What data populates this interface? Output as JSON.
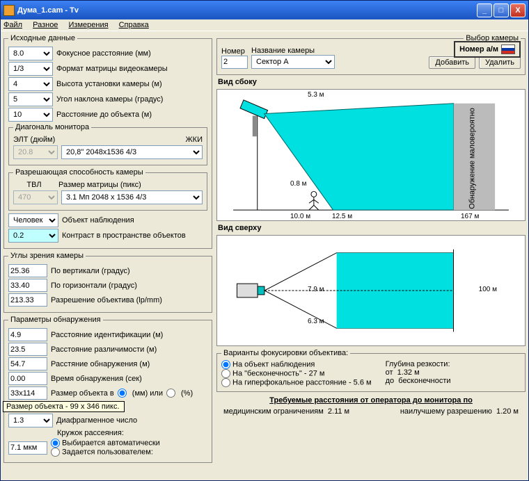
{
  "title": "Дума_1.cam - Tv",
  "menu": {
    "file": "Файл",
    "misc": "Разное",
    "meas": "Измерения",
    "help": "Справка"
  },
  "src": {
    "legend": "Исходные данные",
    "focal": {
      "val": "8.0",
      "lbl": "Фокусное расстояние (мм)"
    },
    "format": {
      "val": "1/3",
      "lbl": "Формат матрицы видеокамеры"
    },
    "height": {
      "val": "4",
      "lbl": "Высота установки камеры (м)"
    },
    "tilt": {
      "val": "5",
      "lbl": "Угол наклона камеры (градус)"
    },
    "dist": {
      "val": "10",
      "lbl": "Расстояние до объекта (м)"
    }
  },
  "mon": {
    "legend": "Диагональ монитора",
    "crt_lbl": "ЭЛТ (дюйм)",
    "crt": "20.8",
    "lcd_lbl": "ЖКИ",
    "lcd": "20,8\"   2048x1536  4/3"
  },
  "res": {
    "legend": "Разрешающая способность камеры",
    "tvl_lbl": "ТВЛ",
    "tvl": "470",
    "mat_lbl": "Размер матрицы (пикс)",
    "mat": "3.1 Мп  2048 x 1536  4/3"
  },
  "obj": {
    "type": "Человек",
    "type_lbl": "Объект наблюдения",
    "contrast": "0.2",
    "contrast_lbl": "Контраст в пространстве объектов"
  },
  "ang": {
    "legend": "Углы зрения камеры",
    "vert": "25.36",
    "vert_lbl": "По вертикали (градус)",
    "horiz": "33.40",
    "horiz_lbl": "По горизонтали (градус)",
    "lens": "213.33",
    "lens_lbl": "Разрешение объектива (lp/mm)"
  },
  "det": {
    "legend": "Параметры обнаружения",
    "id": "4.9",
    "id_lbl": "Расстояние идентификации (м)",
    "rec": "23.5",
    "rec_lbl": "Расстояние различимости (м)",
    "dete": "54.7",
    "dete_lbl": "Расстяние обнаружения (м)",
    "time": "0.00",
    "time_lbl": "Время обнаружения (сек)",
    "size": "33x114",
    "size_lbl": "Размер объекта в",
    "mm": "(мм) или",
    "pct": "(%)",
    "tooltip": "Размер объекта - 99 x 346 пикс.",
    "aperture": "1.3",
    "aperture_lbl": "Диафрагменное число",
    "circle_lbl": "Кружок рассеяния:",
    "auto": "Выбирается автоматически",
    "manual": "Задается пользователем:",
    "coc": "7.1 мкм"
  },
  "cam": {
    "legend": "Выбор камеры",
    "num_lbl": "Номер",
    "num": "2",
    "name_lbl": "Название камеры",
    "name": "Сектор А",
    "add": "Добавить",
    "del": "Удалить",
    "vehicle": "Номер а/м"
  },
  "side": {
    "title": "Вид сбоку",
    "d53": "5.3 м",
    "d08": "0.8 м",
    "d100": "10.0 м",
    "d125": "12.5 м",
    "d167": "167 м",
    "unlikely": "Обнаружение маловероятно"
  },
  "top": {
    "title": "Вид сверху",
    "d79": "7.9 м",
    "d63": "6.3 м",
    "d100": "100 м"
  },
  "focus": {
    "legend": "Варианты фокусировки объектива:",
    "dof": "Глубина резкости:",
    "o1": "На объект наблюдения",
    "o2": "На \"бесконечность\" -",
    "o2v": "27 м",
    "o3": "На гиперфокальное расстояние -",
    "o3v": "5.6 м",
    "from": "от",
    "from_v": "1.32 м",
    "to": "до",
    "to_v": "бесконечности"
  },
  "req": {
    "title": "Требуемые расстояния от оператора до монитора по",
    "med": "медицинским ограничениям",
    "med_v": "2.11 м",
    "best": "наилучшему разрешению",
    "best_v": "1.20 м"
  }
}
